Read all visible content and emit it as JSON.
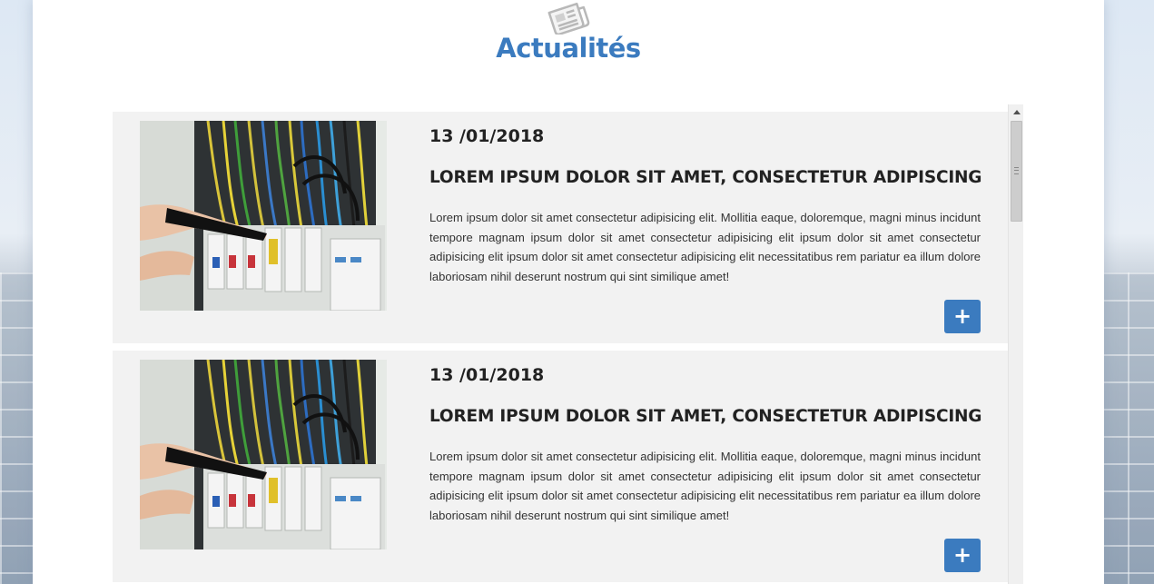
{
  "section": {
    "icon": "newspaper-icon",
    "title": "Actualités"
  },
  "colors": {
    "accent": "#3b7bbf",
    "card_bg": "#f2f2f2",
    "text": "#222222"
  },
  "news": [
    {
      "date": "13 /01/2018",
      "title": "LOREM IPSUM DOLOR SIT AMET, CONSECTETUR ADIPISCING",
      "text": "Lorem ipsum dolor sit amet consectetur adipisicing elit. Mollitia eaque, doloremque, magni minus incidunt tempore magnam ipsum dolor sit amet consectetur adipisicing elit ipsum dolor sit amet consectetur adipisicing elit ipsum dolor sit amet consectetur adipisicing elit necessitatibus rem pariatur ea illum dolore laboriosam nihil deserunt nostrum qui sint similique amet!",
      "button": "+",
      "image": "electrical-panel-photo"
    },
    {
      "date": "13 /01/2018",
      "title": "LOREM IPSUM DOLOR SIT AMET, CONSECTETUR ADIPISCING",
      "text": "Lorem ipsum dolor sit amet consectetur adipisicing elit. Mollitia eaque, doloremque, magni minus incidunt tempore magnam ipsum dolor sit amet consectetur adipisicing elit ipsum dolor sit amet consectetur adipisicing elit ipsum dolor sit amet consectetur adipisicing elit necessitatibus rem pariatur ea illum dolore laboriosam nihil deserunt nostrum qui sint similique amet!",
      "button": "+",
      "image": "electrical-panel-photo"
    }
  ]
}
